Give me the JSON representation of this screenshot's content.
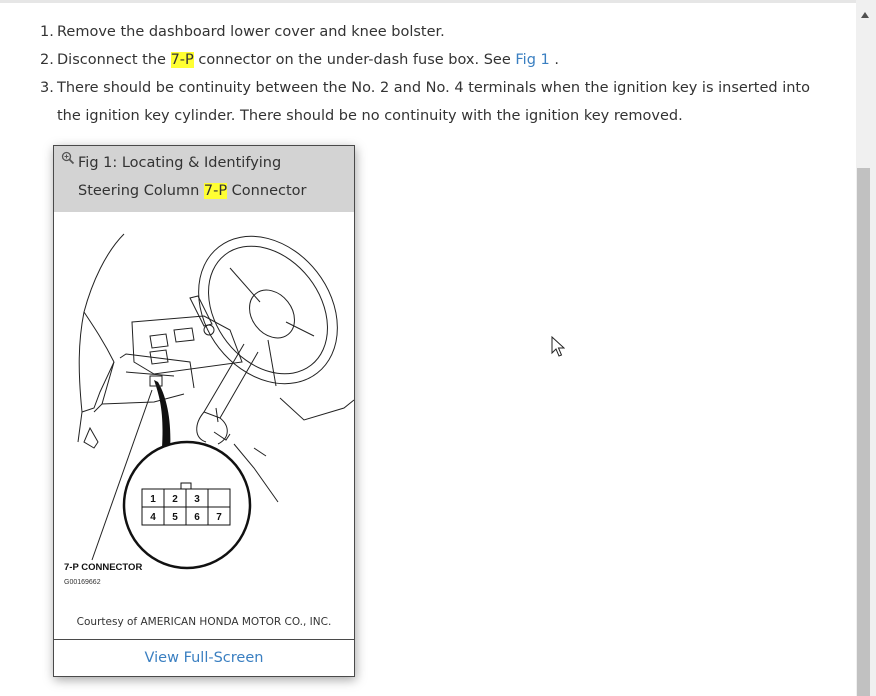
{
  "steps": [
    {
      "num": "1.",
      "text": "Remove the dashboard lower cover and knee bolster."
    },
    {
      "num": "2.",
      "before": "Disconnect the ",
      "highlight": "7-P",
      "after": " connector on the under-dash fuse box. See ",
      "link": "Fig 1",
      "end": " ."
    },
    {
      "num": "3.",
      "text": "There should be continuity between the No. 2 and No. 4 terminals when the ignition key is inserted into the ignition key cylinder. There should be no continuity with the ignition key removed."
    }
  ],
  "figure": {
    "title_before": "Fig 1: Locating & Identifying Steering Column ",
    "title_highlight": "7-P",
    "title_after": " Connector",
    "connector_label": "7-P CONNECTOR",
    "image_code": "G00169662",
    "pins_row1": [
      "1",
      "2",
      "3"
    ],
    "pins_row2": [
      "4",
      "5",
      "6",
      "7"
    ],
    "courtesy": "Courtesy of AMERICAN HONDA MOTOR CO., INC.",
    "fullscreen_label": "View Full-Screen"
  },
  "colors": {
    "highlight": "#ffff33",
    "link": "#3a7fc1",
    "figure_header_bg": "#d3d3d3"
  },
  "icons": {
    "zoom": "zoom-in-icon",
    "cursor": "mouse-pointer-icon"
  }
}
